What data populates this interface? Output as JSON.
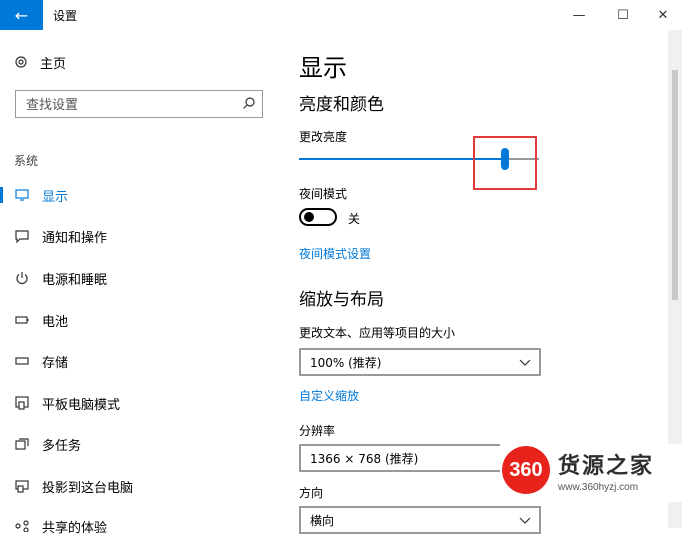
{
  "window": {
    "title": "设置",
    "back_icon": "arrow-left-icon",
    "minimize": "—",
    "maximize": "☐",
    "close": "✕"
  },
  "sidebar": {
    "home_label": "主页",
    "search_placeholder": "查找设置",
    "section_label": "系统",
    "items": [
      {
        "label": "显示",
        "icon": "monitor-icon",
        "active": true
      },
      {
        "label": "通知和操作",
        "icon": "notification-icon"
      },
      {
        "label": "电源和睡眠",
        "icon": "power-icon"
      },
      {
        "label": "电池",
        "icon": "battery-icon"
      },
      {
        "label": "存储",
        "icon": "storage-icon"
      },
      {
        "label": "平板电脑模式",
        "icon": "tablet-icon"
      },
      {
        "label": "多任务",
        "icon": "multitask-icon"
      },
      {
        "label": "投影到这台电脑",
        "icon": "project-icon"
      },
      {
        "label": "共享的体验",
        "icon": "share-icon"
      }
    ]
  },
  "main": {
    "page_title": "显示",
    "brightness_heading": "亮度和颜色",
    "brightness_label": "更改亮度",
    "brightness_value": 0.86,
    "night_mode_label": "夜间模式",
    "night_mode_state": "关",
    "night_mode_settings_link": "夜间模式设置",
    "scale_heading": "缩放与布局",
    "scale_label": "更改文本、应用等项目的大小",
    "scale_value": "100% (推荐)",
    "custom_scale_link": "自定义缩放",
    "resolution_label": "分辨率",
    "resolution_value": "1366 × 768 (推荐)",
    "orientation_label": "方向",
    "orientation_value": "横向"
  },
  "watermark": {
    "badge": "360",
    "name": "货源之家",
    "url": "www.360hyzj.com"
  },
  "colors": {
    "accent": "#0078d7",
    "highlight": "#e03c3c"
  }
}
